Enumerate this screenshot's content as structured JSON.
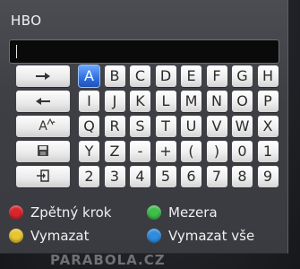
{
  "dialog": {
    "title": "HBO",
    "input_value": ""
  },
  "keyboard": {
    "selected_key": "A",
    "function_keys": [
      {
        "icon": "arrow-right-icon"
      },
      {
        "icon": "arrow-left-icon"
      },
      {
        "icon": "case-toggle-icon",
        "glyph": "A"
      },
      {
        "icon": "save-icon"
      },
      {
        "icon": "confirm-enter-icon"
      }
    ],
    "rows": [
      [
        "A",
        "B",
        "C",
        "D",
        "E",
        "F",
        "G",
        "H"
      ],
      [
        "I",
        "J",
        "K",
        "L",
        "M",
        "N",
        "O",
        "P"
      ],
      [
        "Q",
        "R",
        "S",
        "T",
        "U",
        "V",
        "W",
        "X"
      ],
      [
        "Y",
        "Z",
        "-",
        "+",
        "(",
        ")",
        "0",
        "1"
      ],
      [
        "2",
        "3",
        "4",
        "5",
        "6",
        "7",
        "8",
        "9"
      ]
    ]
  },
  "legend": {
    "red": {
      "label": "Zpětný krok",
      "color": "#d9262b"
    },
    "green": {
      "label": "Mezera",
      "color": "#3fbf4a"
    },
    "yellow": {
      "label": "Vymazat",
      "color": "#e8c630"
    },
    "blue": {
      "label": "Vymazat vše",
      "color": "#2f8de0"
    }
  },
  "watermark": "PARABOLA.CZ"
}
